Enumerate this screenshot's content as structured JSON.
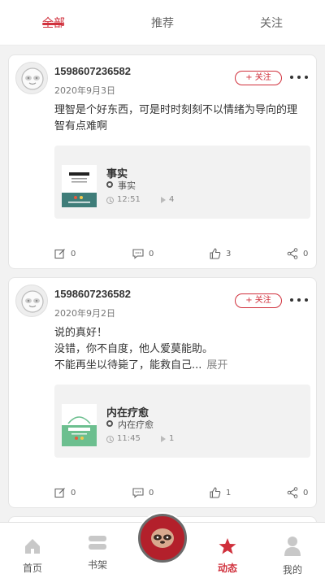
{
  "top_tabs": [
    {
      "label": "全部",
      "active": true
    },
    {
      "label": "推荐",
      "active": false
    },
    {
      "label": "关注",
      "active": false
    }
  ],
  "posts": [
    {
      "username": "1598607236582",
      "date": "2020年9月3日",
      "follow_label": "+ 关注",
      "content_lines": [
        "理智是个好东西，可是时时刻刻不以情绪为导向的理智有点难啊"
      ],
      "expand_label": "",
      "book": {
        "title": "事实",
        "author": "事实",
        "duration": "12:51",
        "plays": "4"
      },
      "actions": {
        "edit": "0",
        "comment": "0",
        "like": "3",
        "share": "0"
      }
    },
    {
      "username": "1598607236582",
      "date": "2020年9月2日",
      "follow_label": "+ 关注",
      "content_lines": [
        "说的真好！",
        "没错，你不自度，他人爱莫能助。",
        "不能再坐以待毙了，能救自己..."
      ],
      "expand_label": "展开",
      "book": {
        "title": "内在疗愈",
        "author": "内在疗愈",
        "duration": "11:45",
        "plays": "1"
      },
      "actions": {
        "edit": "0",
        "comment": "0",
        "like": "1",
        "share": "0"
      }
    }
  ],
  "bottom_nav": [
    {
      "label": "首页",
      "icon": "home-icon",
      "active": false
    },
    {
      "label": "书架",
      "icon": "bookshelf-icon",
      "active": false
    },
    {
      "label": "",
      "icon": "sloth-center-icon",
      "active": false
    },
    {
      "label": "动态",
      "icon": "star-icon",
      "active": true
    },
    {
      "label": "我的",
      "icon": "person-icon",
      "active": false
    }
  ],
  "colors": {
    "accent": "#d0303c",
    "center_button": "#b3202b",
    "book1_cover": "#3f7d79",
    "book2_cover": "#6cbf8f"
  }
}
